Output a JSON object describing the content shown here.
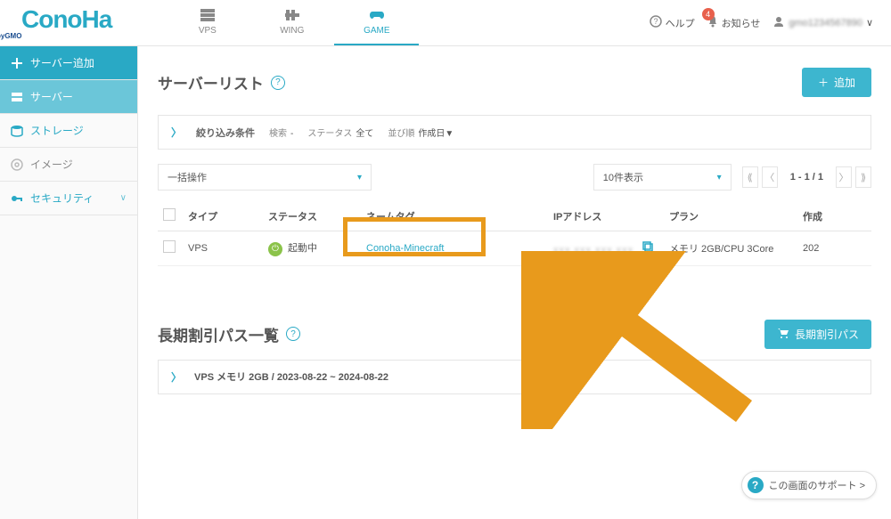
{
  "logo": {
    "text": "ConoHa",
    "sub": "byGMO"
  },
  "service_tabs": [
    {
      "label": "VPS"
    },
    {
      "label": "WING"
    },
    {
      "label": "GAME"
    }
  ],
  "header": {
    "help": "ヘルプ",
    "notice": "お知らせ",
    "notice_count": "4",
    "user_masked": "gmo1234567890",
    "chev": "∨"
  },
  "sidebar": {
    "add": "サーバー追加",
    "server": "サーバー",
    "storage": "ストレージ",
    "image": "イメージ",
    "security": "セキュリティ",
    "chev": "∨"
  },
  "server_list": {
    "title": "サーバーリスト",
    "add_btn": "追加",
    "filter": {
      "title": "絞り込み条件",
      "search_label": "検索",
      "search_val": "-",
      "status_label": "ステータス",
      "status_val": "全て",
      "sort_label": "並び順",
      "sort_val": "作成日▼"
    },
    "bulk": "一括操作",
    "per_page": "10件表示",
    "page_info": "1 - 1 / 1",
    "cols": {
      "type": "タイプ",
      "status": "ステータス",
      "nametag": "ネームタグ",
      "ip": "IPアドレス",
      "plan": "プラン",
      "created": "作成"
    },
    "row": {
      "type": "VPS",
      "status": "起動中",
      "nametag": "Conoha-Minecraft",
      "ip": "xxx.xxx.xxx.xxx",
      "plan": "メモリ 2GB/CPU 3Core",
      "created": "202"
    }
  },
  "long_term": {
    "title": "長期割引パス一覧",
    "btn": "長期割引パス",
    "row": "VPS メモリ 2GB / 2023-08-22 ~ 2024-08-22"
  },
  "support_btn": "この画面のサポート >"
}
